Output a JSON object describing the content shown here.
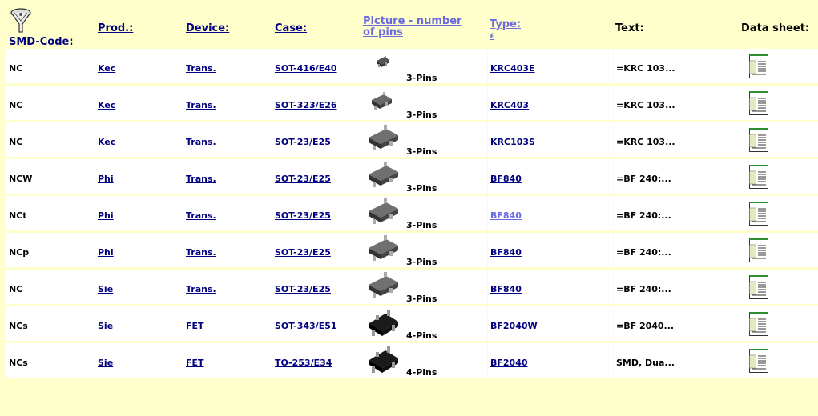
{
  "header": {
    "smd_code": "SMD-Code:",
    "prod": "Prod.:",
    "device": "Device:",
    "case": "Case:",
    "picture": "Picture - number of pins",
    "type": "Type:",
    "type_sub": "£",
    "text": "Text:",
    "datasheet": "Data sheet:"
  },
  "rows": [
    {
      "code": "NC",
      "prod": "Kec",
      "device": "Trans.",
      "case": "SOT-416/E40",
      "pins": "3-Pins",
      "type": "KRC403E",
      "text": "=KRC 103...",
      "pkg": "tiny"
    },
    {
      "code": "NC",
      "prod": "Kec",
      "device": "Trans.",
      "case": "SOT-323/E26",
      "pins": "3-Pins",
      "type": "KRC403",
      "text": "=KRC 103...",
      "pkg": "small"
    },
    {
      "code": "NC",
      "prod": "Kec",
      "device": "Trans.",
      "case": "SOT-23/E25",
      "pins": "3-Pins",
      "type": "KRC103S",
      "text": "=KRC 103...",
      "pkg": "sot23"
    },
    {
      "code": "NCW",
      "prod": "Phi",
      "device": "Trans.",
      "case": "SOT-23/E25",
      "pins": "3-Pins",
      "type": "BF840",
      "text": "=BF 240:...",
      "pkg": "sot23"
    },
    {
      "code": "NCt",
      "prod": "Phi",
      "device": "Trans.",
      "case": "SOT-23/E25",
      "pins": "3-Pins",
      "type": "BF840",
      "text": "=BF 240:...",
      "pkg": "sot23"
    },
    {
      "code": "NCp",
      "prod": "Phi",
      "device": "Trans.",
      "case": "SOT-23/E25",
      "pins": "3-Pins",
      "type": "BF840",
      "text": "=BF 240:...",
      "pkg": "sot23"
    },
    {
      "code": "NC",
      "prod": "Sie",
      "device": "Trans.",
      "case": "SOT-23/E25",
      "pins": "3-Pins",
      "type": "BF840",
      "text": "=BF 240:...",
      "pkg": "sot23"
    },
    {
      "code": "NCs",
      "prod": "Sie",
      "device": "FET",
      "case": "SOT-343/E51",
      "pins": "4-Pins",
      "type": "BF2040W",
      "text": "=BF 2040...",
      "pkg": "four"
    },
    {
      "code": "NCs",
      "prod": "Sie",
      "device": "FET",
      "case": "TO-253/E34",
      "pins": "4-Pins",
      "type": "BF2040",
      "text": "SMD, Dua...",
      "pkg": "four"
    }
  ],
  "visited_row": 4,
  "colors": {
    "background": "#ffffcc",
    "link": "#000080",
    "visited": "#6b6bdf",
    "cell": "#ffffff"
  },
  "icons": {
    "filter": "funnel-icon",
    "datasheet": "pdf-document-icon"
  }
}
